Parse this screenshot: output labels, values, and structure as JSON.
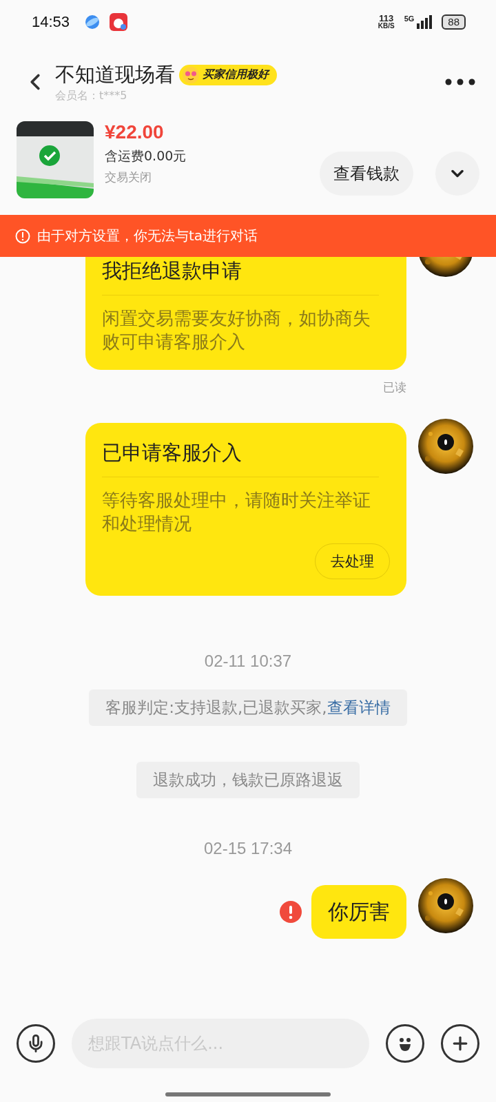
{
  "status_bar": {
    "time": "14:53",
    "speed_value": "113",
    "speed_unit": "KB/S",
    "network": "5G",
    "battery": "88"
  },
  "header": {
    "title": "不知道现场看",
    "badge": "买家信用极好",
    "member": "会员名：t***5"
  },
  "product": {
    "price": "¥22.00",
    "shipping": "含运费0.00元",
    "status": "交易关闭",
    "button": "查看钱款"
  },
  "banner": {
    "text": "由于对方设置，你无法与ta进行对话"
  },
  "messages": [
    {
      "kind": "card",
      "title": "我拒绝退款申请",
      "body": "闲置交易需要友好协商，如协商失败可申请客服介入",
      "read": "已读"
    },
    {
      "kind": "card",
      "title": "已申请客服介入",
      "body": "等待客服处理中，请随时关注举证和处理情况",
      "button": "去处理"
    },
    {
      "kind": "timestamp",
      "text": "02-11 10:37"
    },
    {
      "kind": "notice",
      "text": "客服判定:支持退款,已退款买家,",
      "link": "查看详情"
    },
    {
      "kind": "notice",
      "text": "退款成功，钱款已原路退返"
    },
    {
      "kind": "timestamp",
      "text": "02-15 17:34"
    },
    {
      "kind": "text",
      "text": "你厉害",
      "failed": true
    }
  ],
  "input": {
    "placeholder": "想跟TA说点什么..."
  }
}
